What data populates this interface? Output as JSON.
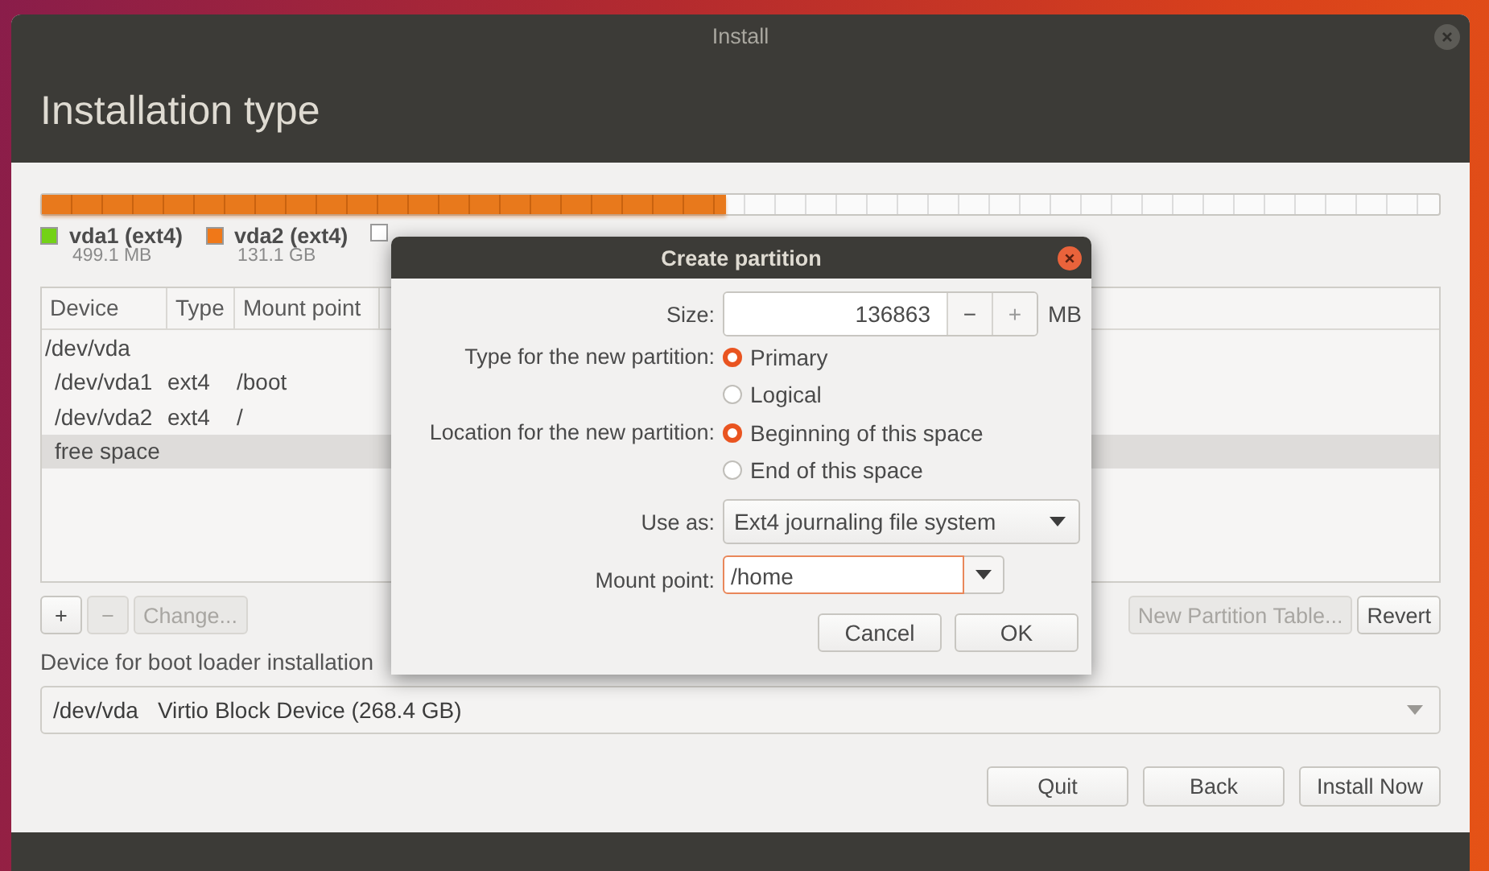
{
  "window": {
    "title": "Install",
    "heading": "Installation type"
  },
  "partition_bar": {
    "level": 0.49
  },
  "legend": [
    {
      "name": "vda1 (ext4)",
      "size": "499.1 MB",
      "color": "#73d216"
    },
    {
      "name": "vda2 (ext4)",
      "size": "131.1 GB",
      "color": "#f07818"
    },
    {
      "color": "#ffffff"
    }
  ],
  "table": {
    "columns": [
      "Device",
      "Type",
      "Mount point"
    ],
    "rows": [
      {
        "device": "/dev/vda",
        "selected": false,
        "children": [
          {
            "device": "/dev/vda1",
            "type": "ext4",
            "mount_point": "/boot",
            "selected": false
          },
          {
            "device": "/dev/vda2",
            "type": "ext4",
            "mount_point": "/",
            "selected": false
          },
          {
            "device": "free space",
            "selected": true
          }
        ]
      }
    ]
  },
  "partition_buttons": [
    {
      "label": "+",
      "disabled": false
    },
    {
      "label": "−",
      "disabled": true
    },
    {
      "label": "Change...",
      "disabled": true
    }
  ],
  "table_buttons": [
    {
      "label": "New Partition Table...",
      "disabled": true
    },
    {
      "label": "Revert",
      "disabled": false
    }
  ],
  "boot_loader": {
    "label": "Device for boot loader installation",
    "device": "/dev/vda",
    "description": "Virtio Block Device (268.4 GB)"
  },
  "nav_buttons": [
    "Quit",
    "Back",
    "Install Now"
  ],
  "dialog": {
    "title": "Create partition",
    "size": {
      "label": "Size:",
      "value": "136863",
      "decrement": "−",
      "increment": "+",
      "unit": "MB"
    },
    "type": {
      "label": "Type for the new partition:",
      "options": [
        {
          "label": "Primary",
          "selected": true
        },
        {
          "label": "Logical",
          "selected": false
        }
      ]
    },
    "location": {
      "label": "Location for the new partition:",
      "options": [
        {
          "label": "Beginning of this space",
          "selected": true
        },
        {
          "label": "End of this space",
          "selected": false
        }
      ]
    },
    "use_as": {
      "label": "Use as:",
      "value": "Ext4 journaling file system"
    },
    "mount_point": {
      "label": "Mount point:",
      "value": "/home",
      "focused": true
    },
    "buttons": [
      "Cancel",
      "OK"
    ]
  }
}
